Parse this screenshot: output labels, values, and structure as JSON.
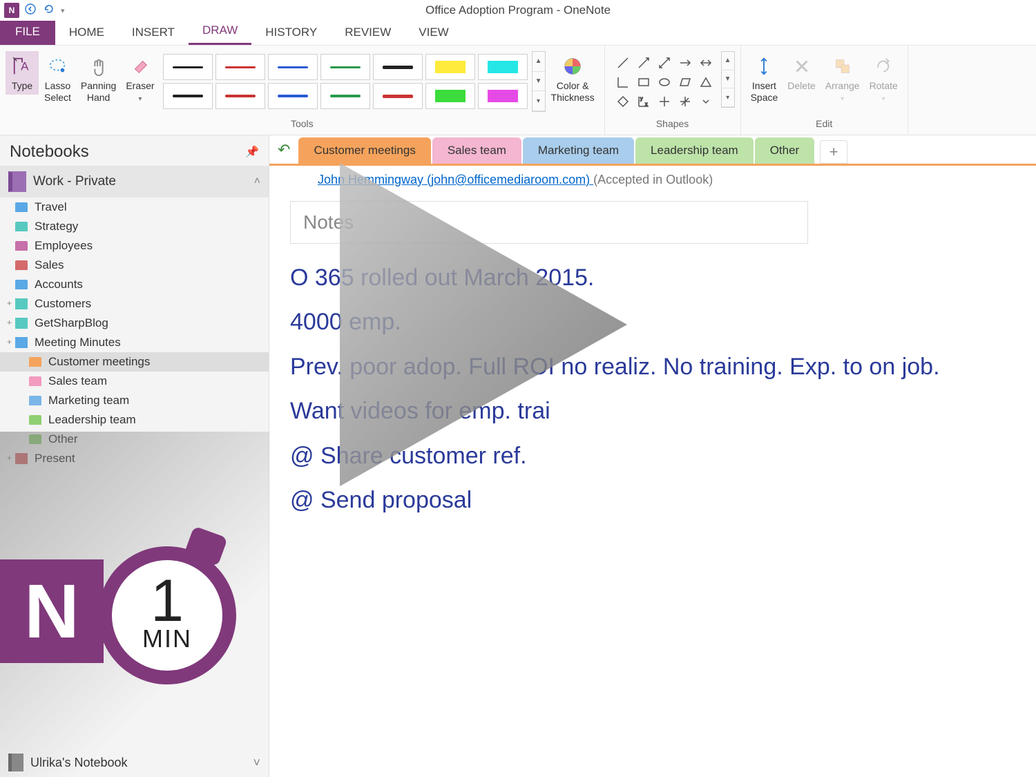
{
  "window_title": "Office Adoption Program - OneNote",
  "ribbon_tabs": [
    "FILE",
    "HOME",
    "INSERT",
    "DRAW",
    "HISTORY",
    "REVIEW",
    "VIEW"
  ],
  "active_ribbon_tab": "DRAW",
  "ribbon": {
    "type_btn": "Type",
    "lasso_btn": "Lasso\nSelect",
    "panning_btn": "Panning\nHand",
    "eraser_btn": "Eraser",
    "tools_group": "Tools",
    "color_btn": "Color &\nThickness",
    "insert_space_btn": "Insert\nSpace",
    "delete_btn": "Delete",
    "arrange_btn": "Arrange",
    "rotate_btn": "Rotate",
    "shapes_group": "Shapes",
    "edit_group": "Edit"
  },
  "sidebar": {
    "title": "Notebooks",
    "current_notebook": "Work - Private",
    "sections": [
      {
        "label": "Travel",
        "color": "#5aa9e6",
        "type": "section"
      },
      {
        "label": "Strategy",
        "color": "#58c9c0",
        "type": "section"
      },
      {
        "label": "Employees",
        "color": "#c76fa8",
        "type": "section"
      },
      {
        "label": "Sales",
        "color": "#d46a6a",
        "type": "section"
      },
      {
        "label": "Accounts",
        "color": "#5aa9e6",
        "type": "section"
      },
      {
        "label": "Customers",
        "color": "#58c9c0",
        "type": "group"
      },
      {
        "label": "GetSharpBlog",
        "color": "#58c9c0",
        "type": "group"
      },
      {
        "label": "Meeting Minutes",
        "color": "#5aa9e6",
        "type": "group",
        "expanded": true
      },
      {
        "label": "Customer meetings",
        "color": "#f5a35c",
        "type": "sub",
        "selected": true
      },
      {
        "label": "Sales team",
        "color": "#f29ac0",
        "type": "sub"
      },
      {
        "label": "Marketing team",
        "color": "#7bb6e8",
        "type": "sub"
      },
      {
        "label": "Leadership team",
        "color": "#8fcf72",
        "type": "sub"
      },
      {
        "label": "Other",
        "color": "#8fcf72",
        "type": "sub"
      },
      {
        "label": "Present",
        "color": "#d46a6a",
        "type": "group"
      }
    ],
    "other_notebook": "Ulrika's Notebook"
  },
  "section_tabs": [
    {
      "label": "Customer meetings",
      "color": "#f5a35c",
      "active": true
    },
    {
      "label": "Sales team",
      "color": "#f4b6d1"
    },
    {
      "label": "Marketing team",
      "color": "#a9cdec"
    },
    {
      "label": "Leadership team",
      "color": "#bde3a8"
    },
    {
      "label": "Other",
      "color": "#bde3a8"
    }
  ],
  "page": {
    "attendee_name": "John Hemmingway",
    "attendee_email": "john@officemediaroom.com",
    "attendee_status": "(Accepted in Outlook)",
    "notes_heading": "Notes",
    "handwriting": [
      "O 365 rolled out March 2015.",
      "4000 emp.",
      "Prev. poor adop. Full ROI no realiz. No training. Exp. to on job.",
      "Want videos for emp. trai",
      "@ Share customer ref.",
      "@ Send proposal"
    ]
  },
  "badge": {
    "letter": "N",
    "number": "1",
    "unit": "MIN"
  }
}
